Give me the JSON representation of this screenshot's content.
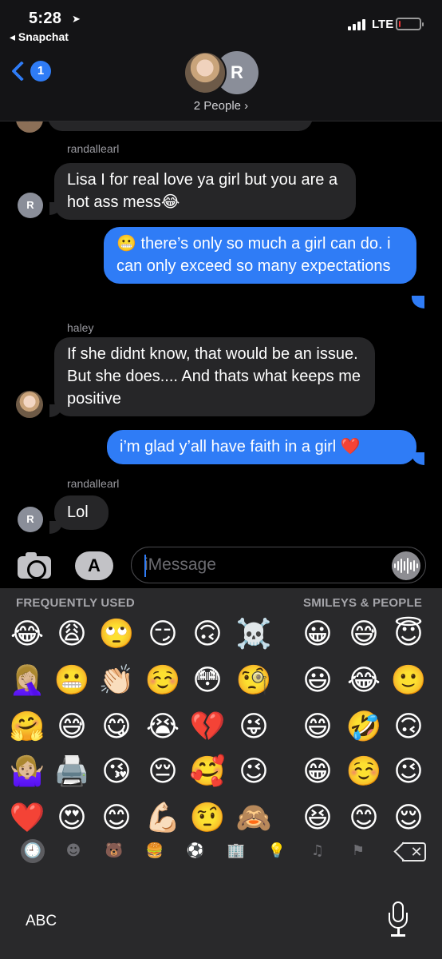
{
  "status_bar": {
    "time": "5:28",
    "location_icon": "location-arrow-icon",
    "back_app": "◂ Snapchat",
    "network": "LTE",
    "battery_level": 0.08
  },
  "header": {
    "unread_count": "1",
    "avatar_initial": "R",
    "participants_label": "2 People ›"
  },
  "messages": [
    {
      "sender": "randallearl",
      "direction": "in",
      "text": "Lisa I for real love ya girl but you are a hot ass mess😂",
      "avatar": "R"
    },
    {
      "sender": "",
      "direction": "out",
      "text": "😬 there’s only so much a girl can do. i can only exceed so many expectations"
    },
    {
      "sender": "haley",
      "direction": "in",
      "text": "If she didnt know, that would be an issue. But she does.... And thats what keeps me positive"
    },
    {
      "sender": "",
      "direction": "out",
      "text": "i’m glad y’all have faith in a girl ❤️"
    },
    {
      "sender": "randallearl",
      "direction": "in",
      "text": "Lol",
      "avatar": "R"
    }
  ],
  "input": {
    "placeholder": "iMessage",
    "app_store_glyph": "A"
  },
  "keyboard": {
    "section_left": "FREQUENTLY USED",
    "section_right": "SMILEYS & PEOPLE",
    "frequently_used": [
      [
        "😂",
        "😩",
        "🙄",
        "😏",
        "🙃",
        "☠️"
      ],
      [
        "🤦🏼‍♀️",
        "😬",
        "👏🏻",
        "☺️",
        "😳",
        "🧐"
      ],
      [
        "🤗",
        "😅",
        "😋",
        "😭",
        "💔",
        "😜"
      ],
      [
        "🤷🏼‍♀️",
        "🖨️",
        "😘",
        "😔",
        "🥰",
        "😉"
      ],
      [
        "❤️",
        "😍",
        "😊",
        "💪🏻",
        "🤨",
        "🙈"
      ]
    ],
    "smileys_people": [
      [
        "😀",
        "😅",
        "😇"
      ],
      [
        "😃",
        "😂",
        "🙂"
      ],
      [
        "😄",
        "🤣",
        "🙃"
      ],
      [
        "😁",
        "☺️",
        "😉"
      ],
      [
        "😆",
        "😊",
        "😌"
      ]
    ],
    "category_icons": [
      "🕘",
      "☻",
      "🐻",
      "🍔",
      "⚽",
      "🏢",
      "💡",
      "♫",
      "⚑"
    ],
    "abc_label": "ABC"
  }
}
